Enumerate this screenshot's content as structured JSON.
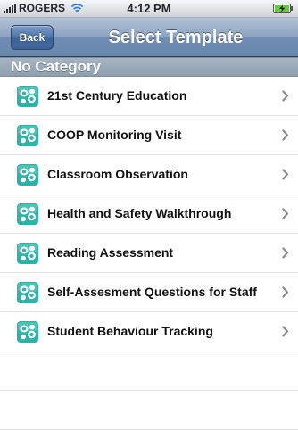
{
  "status_bar": {
    "carrier": "ROGERS",
    "time": "4:12 PM",
    "signal_icon": "signal-bars-icon",
    "wifi_icon": "wifi-icon",
    "battery_icon": "battery-charging-icon"
  },
  "nav_bar": {
    "back_label": "Back",
    "title": "Select Template"
  },
  "section": {
    "header": "No Category"
  },
  "templates": [
    {
      "label": "21st Century Education",
      "icon": "template-icon"
    },
    {
      "label": "COOP Monitoring Visit",
      "icon": "template-icon"
    },
    {
      "label": "Classroom Observation",
      "icon": "template-icon"
    },
    {
      "label": "Health and Safety Walkthrough",
      "icon": "template-icon"
    },
    {
      "label": "Reading Assessment",
      "icon": "template-icon"
    },
    {
      "label": "Self-Assesment Questions for Staff",
      "icon": "template-icon"
    },
    {
      "label": "Student Behaviour Tracking",
      "icon": "template-icon"
    }
  ],
  "colors": {
    "nav_bar": "#7a94b8",
    "section_header": "#9aa9b8",
    "icon_teal": "#2bb3a8"
  }
}
